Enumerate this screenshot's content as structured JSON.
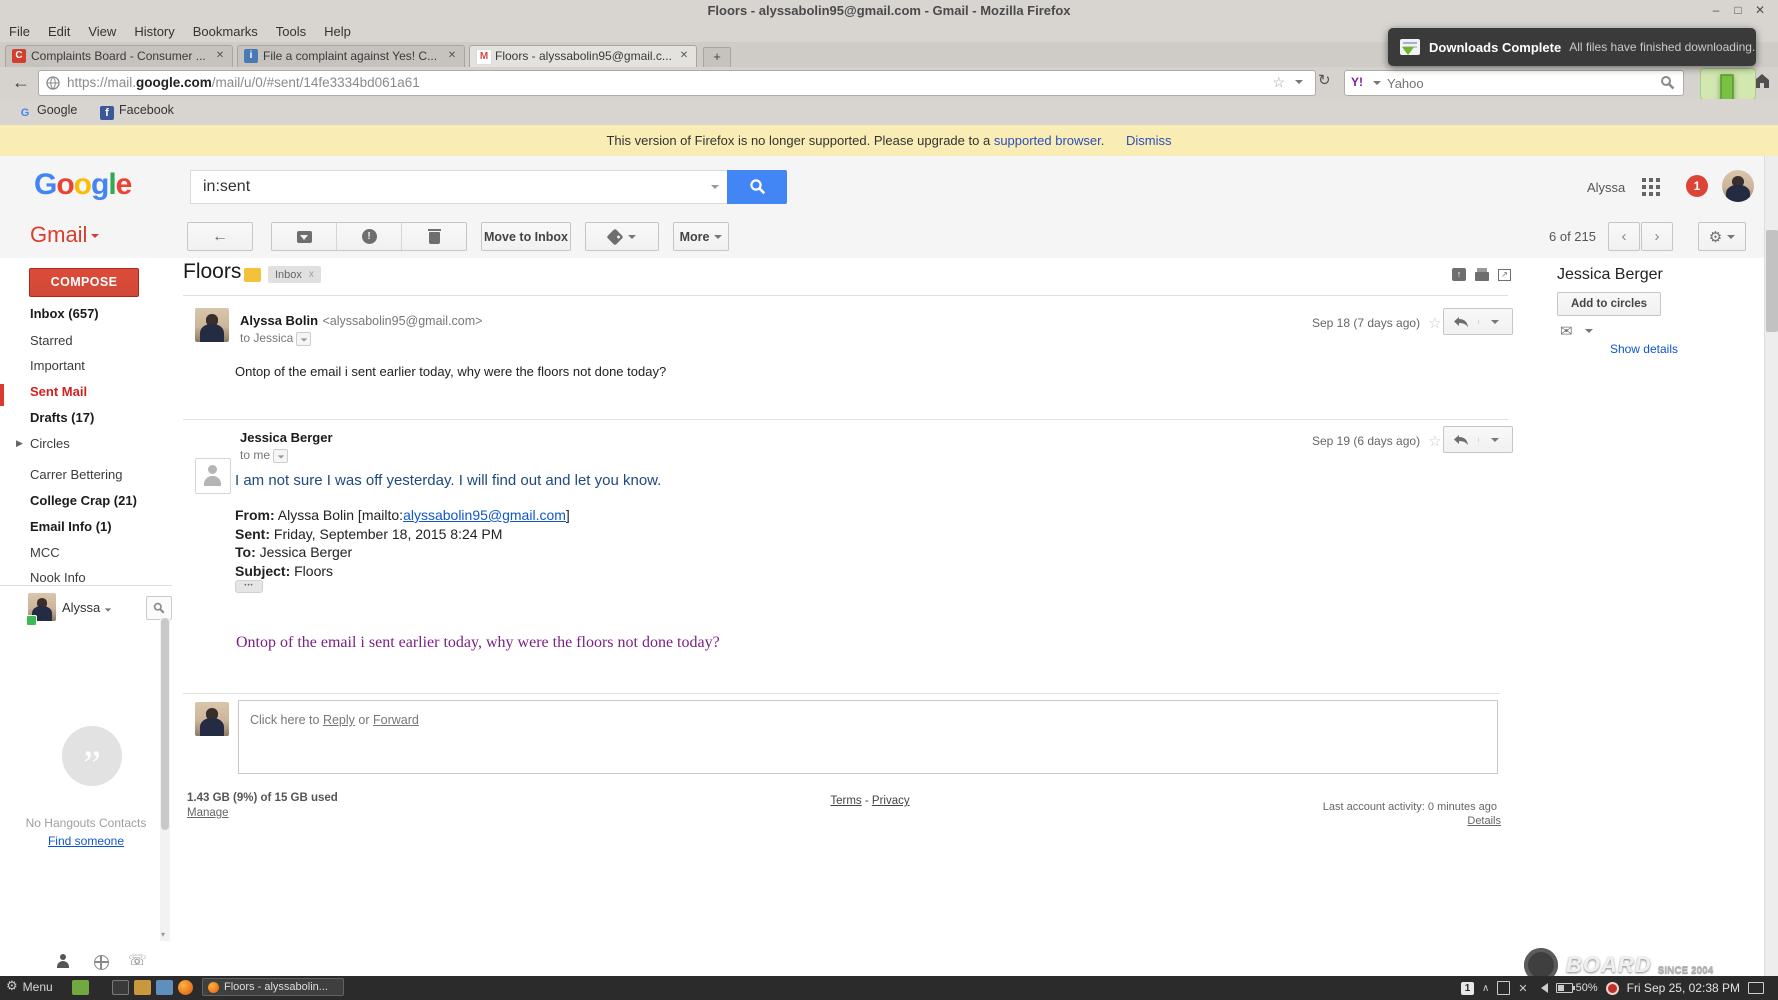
{
  "titlebar": {
    "title": "Floors - alyssabolin95@gmail.com - Gmail - Mozilla Firefox"
  },
  "menubar": {
    "items": [
      "File",
      "Edit",
      "View",
      "History",
      "Bookmarks",
      "Tools",
      "Help"
    ]
  },
  "tabs": [
    {
      "title": "Complaints Board - Consumer ..."
    },
    {
      "title": "File a complaint against Yes! C..."
    },
    {
      "title": "Floors - alyssabolin95@gmail.c..."
    }
  ],
  "navbar": {
    "url_prefix": "https://mail.",
    "url_domain": "google.com",
    "url_path": "/mail/u/0/#sent/14fe3334bd061a61",
    "search_placeholder": "Yahoo"
  },
  "downloads_popup": {
    "title": "Downloads Complete",
    "message": "All files have finished downloading."
  },
  "bookmarks": {
    "google": "Google",
    "facebook": "Facebook"
  },
  "notice": {
    "text": "This version of Firefox is no longer supported. Please upgrade to a",
    "link": "supported browser",
    "suffix": ".",
    "dismiss": "Dismiss"
  },
  "header": {
    "logo_letters": [
      "G",
      "o",
      "o",
      "g",
      "l",
      "e"
    ],
    "search_value": "in:sent",
    "account_name": "Alyssa",
    "badge": "1"
  },
  "toolbar": {
    "move_to_inbox": "Move to Inbox",
    "more": "More",
    "pager": "6 of 215"
  },
  "sidebar": {
    "logo": "Gmail",
    "compose": "COMPOSE",
    "items": [
      {
        "label": "Inbox (657)"
      },
      {
        "label": "Starred"
      },
      {
        "label": "Important"
      },
      {
        "label": "Sent Mail"
      },
      {
        "label": "Drafts (17)"
      },
      {
        "label": "Circles"
      },
      {
        "label": "Carrer Bettering"
      },
      {
        "label": "College Crap (21)"
      },
      {
        "label": "Email Info (1)"
      },
      {
        "label": "MCC"
      },
      {
        "label": "Nook Info"
      }
    ],
    "chat_name": "Alyssa",
    "hangouts_empty": "No Hangouts Contacts",
    "find_someone": "Find someone"
  },
  "thread": {
    "subject": "Floors",
    "chip": "Inbox",
    "chip_close": "x",
    "messages": [
      {
        "sender": "Alyssa Bolin",
        "email": "<alyssabolin95@gmail.com>",
        "recipient": "to Jessica",
        "date": "Sep 18 (7 days ago)",
        "body": "Ontop of the email i sent earlier today, why were the floors not done today?"
      },
      {
        "sender": "Jessica Berger",
        "recipient": "to me",
        "date": "Sep 19 (6 days ago)",
        "body": "I am not sure I was off yesterday. I will find out and let you know.",
        "quote": {
          "from_label": "From:",
          "from_pre": " Alyssa Bolin [mailto:",
          "from_link": "alyssabolin95@gmail.com",
          "from_post": "]",
          "sent_label": "Sent:",
          "sent_value": " Friday, September 18, 2015 8:24 PM",
          "to_label": "To:",
          "to_value": " Jessica Berger",
          "subject_label": "Subject:",
          "subject_value": " Floors"
        },
        "quoted_body": "Ontop of the email i sent earlier today, why were the floors not done today?"
      }
    ],
    "reply_bar": {
      "prefix": "Click here to ",
      "reply": "Reply",
      "or": " or ",
      "forward": "Forward"
    }
  },
  "contact": {
    "name": "Jessica Berger",
    "add": "Add to circles",
    "details": "Show details"
  },
  "footer": {
    "storage": "1.43 GB (9%) of 15 GB used",
    "manage": "Manage",
    "terms": "Terms",
    "sep": " - ",
    "privacy": "Privacy",
    "activity": "Last account activity: 0 minutes ago",
    "details": "Details"
  },
  "watermark": {
    "board": "BOARD",
    "since": "SINCE 2004"
  },
  "taskbar": {
    "menu": "Menu",
    "task": "Floors - alyssabolin...",
    "battery": "50%",
    "clock": "Fri Sep 25, 02:38 PM"
  }
}
